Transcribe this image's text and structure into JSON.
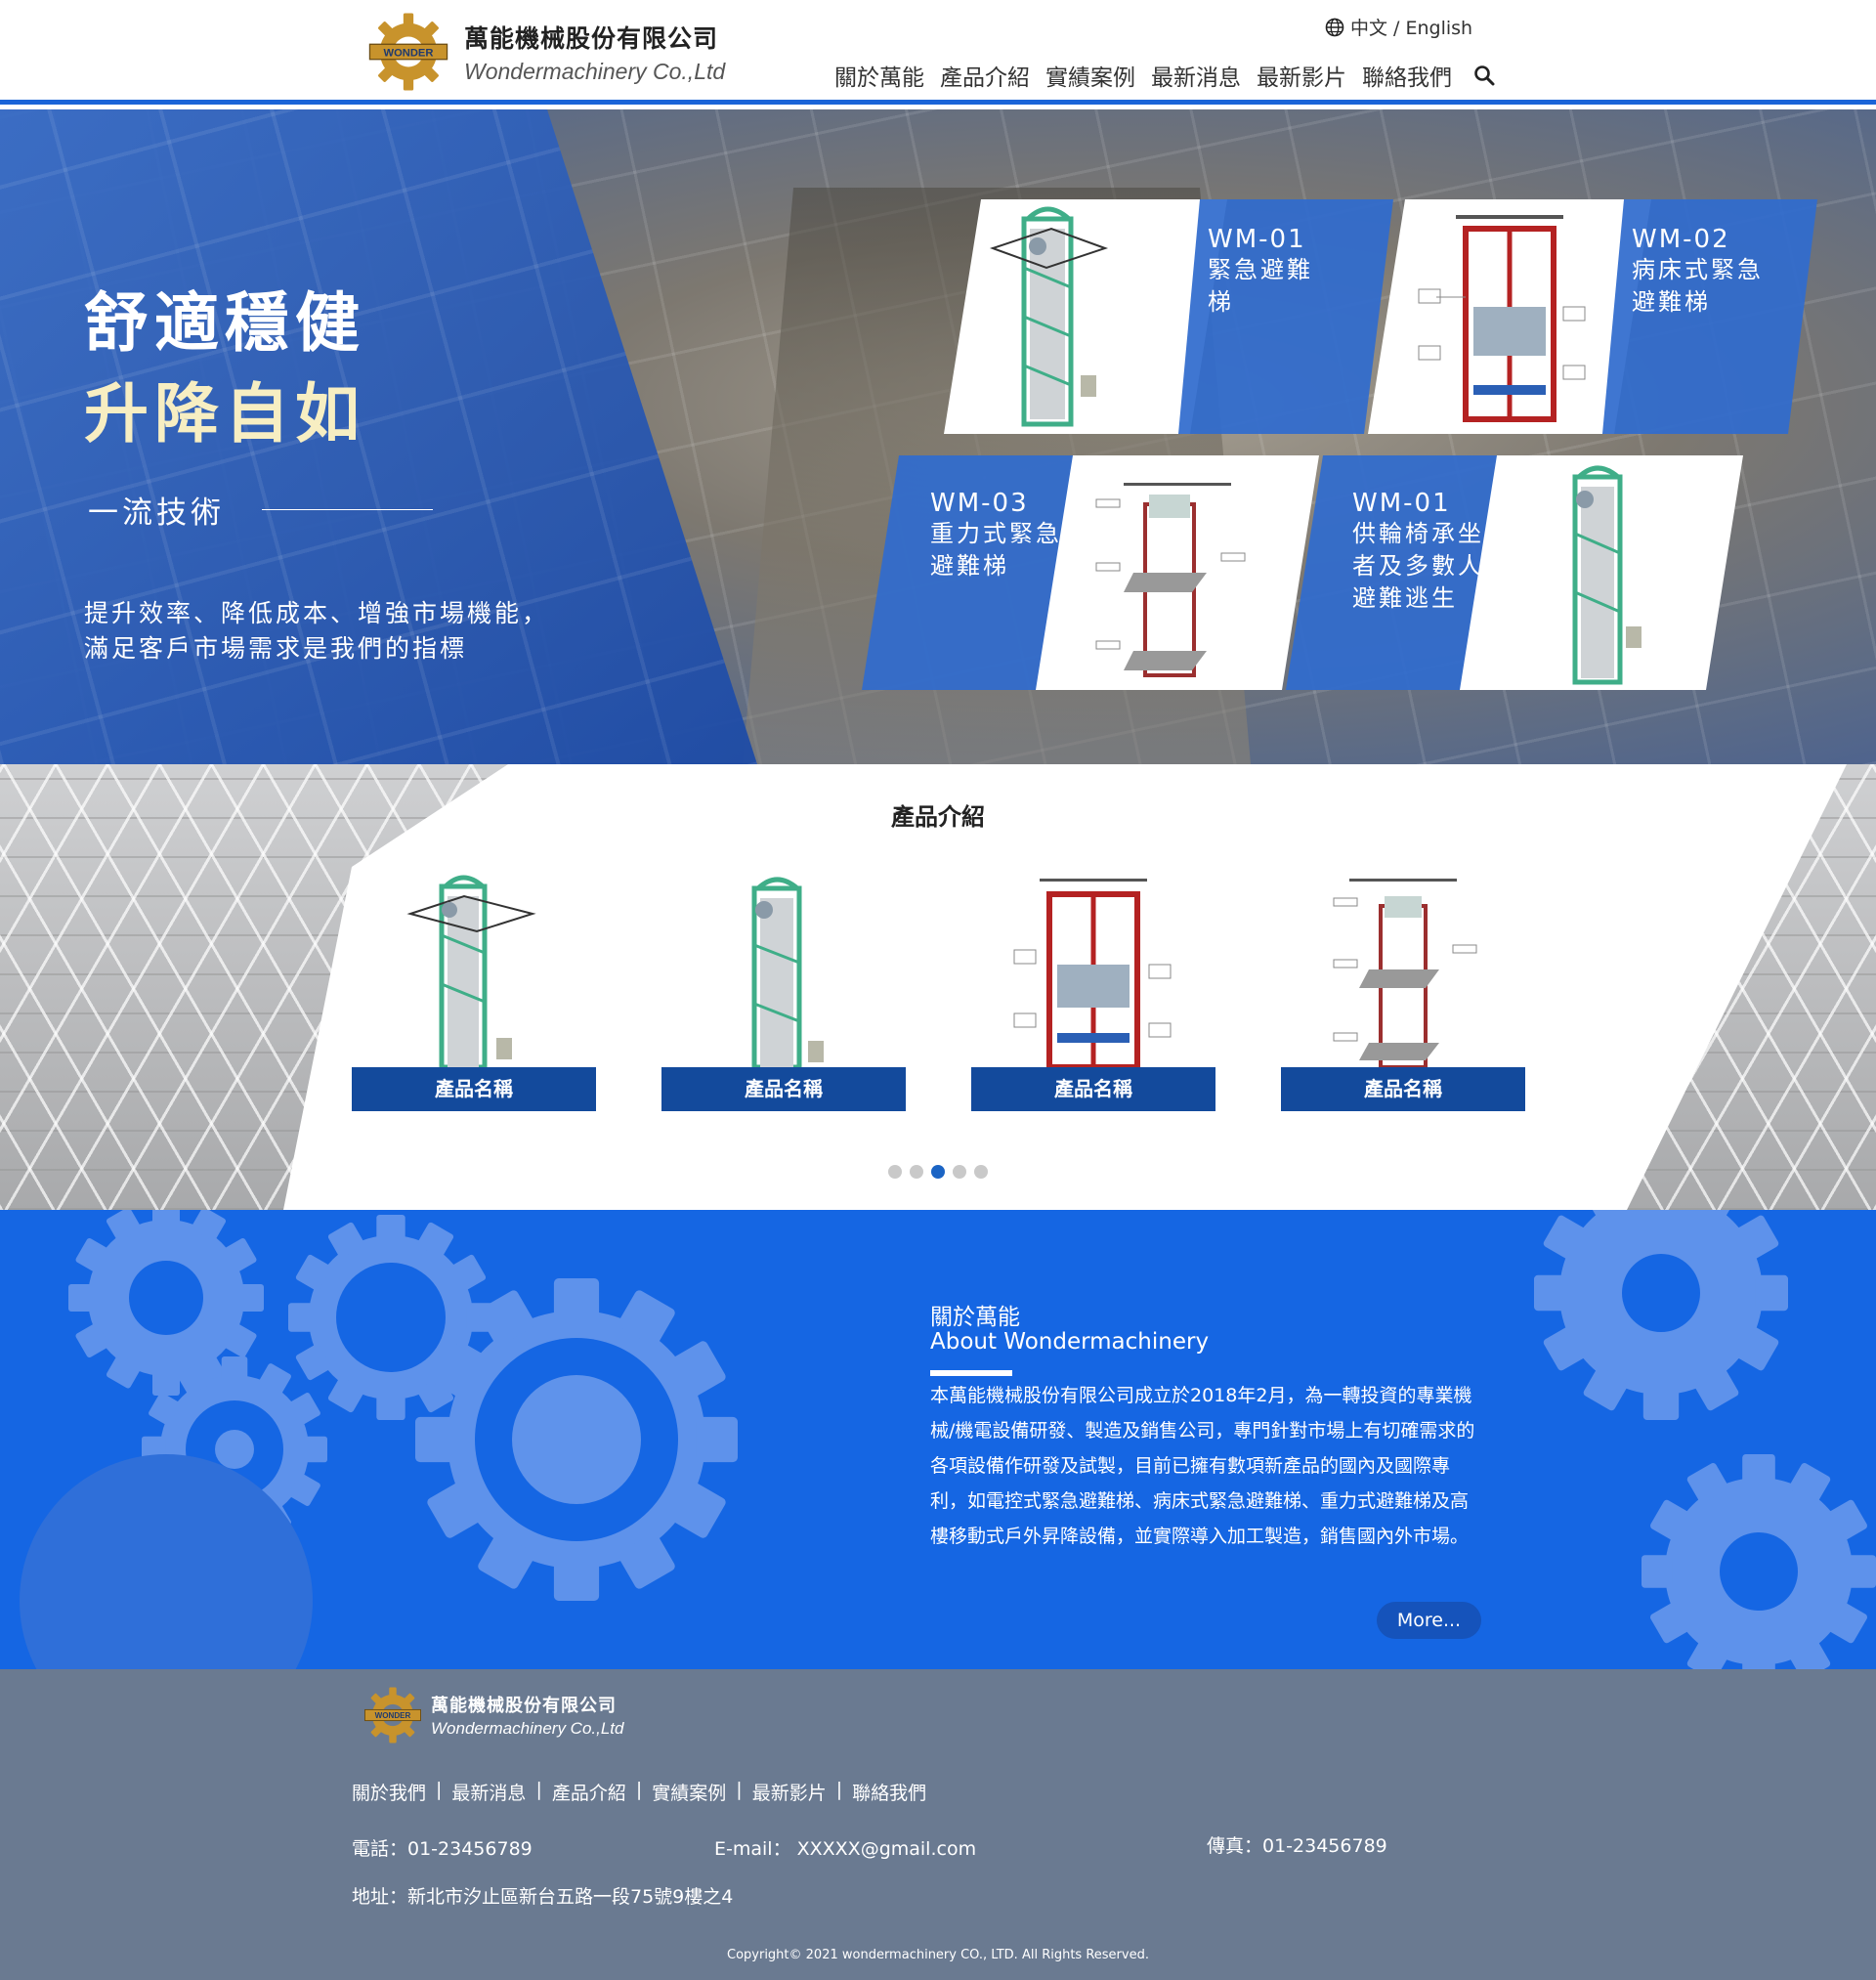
{
  "header": {
    "brand_cn": "萬能機械股份有限公司",
    "brand_en": "Wondermachinery Co.,Ltd",
    "logo_text": "WONDER",
    "language": "中文 / English",
    "nav": [
      "關於萬能",
      "產品介紹",
      "實績案例",
      "最新消息",
      "最新影片",
      "聯絡我們"
    ],
    "search_icon": "search-icon"
  },
  "hero": {
    "title_line1": "舒適穩健",
    "title_line2": "升降自如",
    "subtitle": "一流技術",
    "desc_line1": "提升效率、降低成本、增強市場機能，",
    "desc_line2": "滿足客戶市場需求是我們的指標",
    "cards": [
      {
        "code": "WM-01",
        "name": "緊急避難梯"
      },
      {
        "code": "WM-02",
        "name": "病床式緊急避難梯"
      },
      {
        "code": "WM-03",
        "name": "重力式緊急避難梯"
      },
      {
        "code": "WM-01",
        "name": "供輪椅承坐者及多數人避難逃生"
      }
    ]
  },
  "products": {
    "heading": "產品介紹",
    "items": [
      {
        "name": "產品名稱"
      },
      {
        "name": "產品名稱"
      },
      {
        "name": "產品名稱"
      },
      {
        "name": "產品名稱"
      }
    ],
    "slider_dots": 5,
    "active_dot": 3
  },
  "about": {
    "title_cn": "關於萬能",
    "title_en": "About Wondermachinery",
    "text": "本萬能機械股份有限公司成立於2018年2月，為一轉投資的專業機械/機電設備研發、製造及銷售公司，專門針對市場上有切確需求的各項設備作研發及試製，目前已擁有數項新產品的國內及國際專利，如電控式緊急避難梯、病床式緊急避難梯、重力式避難梯及高樓移動式戶外昇降設備，並實際導入加工製造，銷售國內外市場。",
    "more_label": "More..."
  },
  "footer": {
    "brand_cn": "萬能機械股份有限公司",
    "brand_en": "Wondermachinery Co.,Ltd",
    "links": [
      "關於我們",
      "最新消息",
      "產品介紹",
      "實績案例",
      "最新影片",
      "聯絡我們"
    ],
    "tel": "電話：01-23456789",
    "email": "E-mail： XXXXX@gmail.com",
    "fax": "傳真：01-23456789",
    "address": "地址：新北市汐止區新台五路一段75號9樓之4",
    "copyright": "Copyright© 2021 wondermachinery  CO., LTD. All Rights Reserved."
  },
  "colors": {
    "accent_blue": "#1566e3",
    "dark_blue_bar": "#134a9c",
    "footer_bg": "#6a7a91",
    "gold": "#c8932c",
    "cream": "#f7eec2"
  }
}
